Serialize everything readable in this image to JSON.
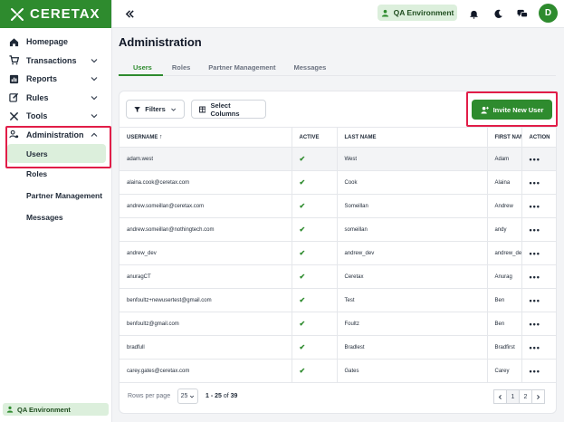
{
  "app": {
    "logo_text": "CERETAX"
  },
  "sidebar": {
    "items": [
      {
        "label": "Homepage"
      },
      {
        "label": "Transactions"
      },
      {
        "label": "Reports"
      },
      {
        "label": "Rules"
      },
      {
        "label": "Tools"
      },
      {
        "label": "Administration"
      }
    ],
    "sub_items": [
      {
        "label": "Users"
      },
      {
        "label": "Roles"
      },
      {
        "label": "Partner Management"
      },
      {
        "label": "Messages"
      }
    ],
    "env_badge": "QA Environment"
  },
  "header": {
    "env_label": "QA Environment",
    "avatar_initial": "D"
  },
  "page": {
    "title": "Administration",
    "tabs": [
      "Users",
      "Roles",
      "Partner Management",
      "Messages"
    ]
  },
  "toolbar": {
    "filters_label": "Filters",
    "select_columns_label": "Select Columns",
    "invite_label": "Invite New User"
  },
  "table": {
    "headers": {
      "username": "USERNAME",
      "active": "ACTIVE",
      "last_name": "LAST NAME",
      "first_name": "FIRST NAM",
      "action": "ACTION"
    },
    "rows": [
      {
        "username": "adam.west",
        "last": "West",
        "first": "Adam"
      },
      {
        "username": "alaina.cook@ceretax.com",
        "last": "Cook",
        "first": "Alaina"
      },
      {
        "username": "andrew.someillan@ceretax.com",
        "last": "Someillan",
        "first": "Andrew"
      },
      {
        "username": "andrew.someillan@nothingtech.com",
        "last": "someillan",
        "first": "andy"
      },
      {
        "username": "andrew_dev",
        "last": "andrew_dev",
        "first": "andrew_de"
      },
      {
        "username": "anuragCT",
        "last": "Ceretax",
        "first": "Anurag"
      },
      {
        "username": "benfoultz+newusertest@gmail.com",
        "last": "Test",
        "first": "Ben"
      },
      {
        "username": "benfoultz@gmail.com",
        "last": "Foultz",
        "first": "Ben"
      },
      {
        "username": "bradfull",
        "last": "Bradlest",
        "first": "Bradfirst"
      },
      {
        "username": "carey.gates@ceretax.com",
        "last": "Gates",
        "first": "Carey"
      }
    ],
    "active_mark": "✔",
    "action_mark": "•••"
  },
  "pagination": {
    "rows_per_page_label": "Rows per page",
    "rows_per_page_value": "25",
    "range_text": "1 - 25",
    "of_text": "of",
    "total": "39",
    "pages": [
      "1",
      "2"
    ]
  },
  "colors": {
    "brand": "#2e8b2e",
    "highlight": "#e11d48"
  }
}
